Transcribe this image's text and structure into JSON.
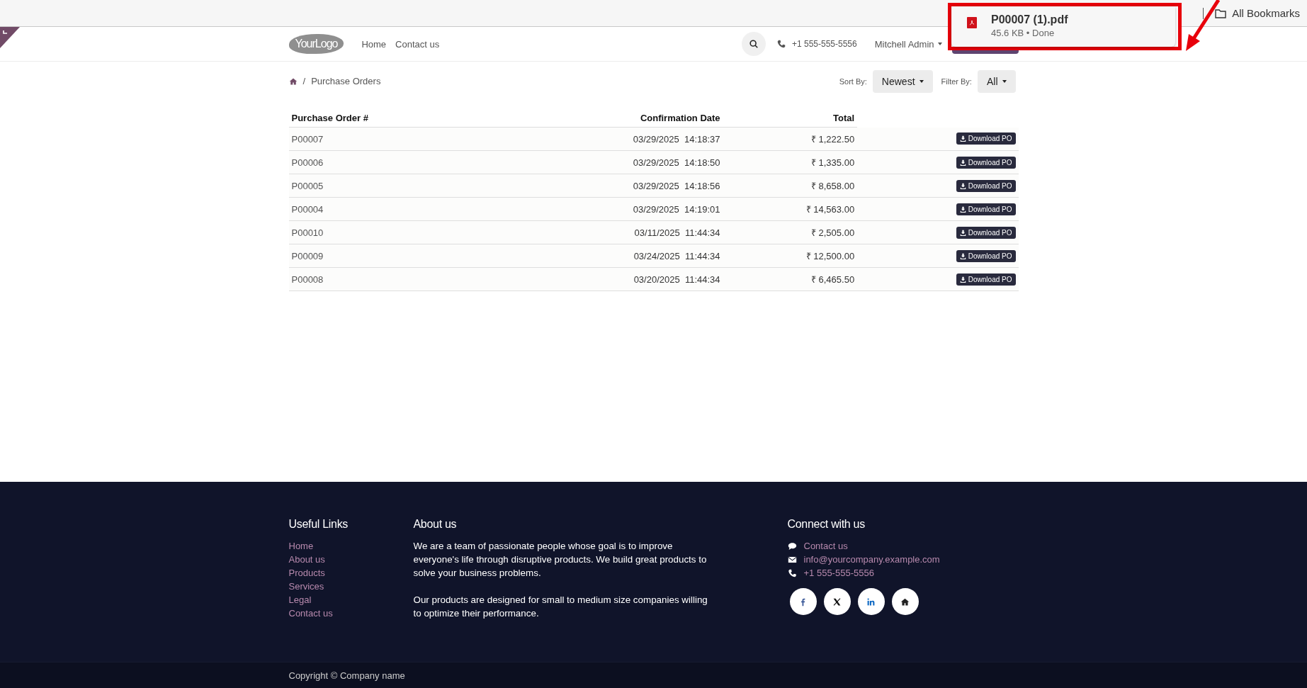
{
  "browser": {
    "bookmarks_label": "All Bookmarks",
    "download": {
      "filename": "P00007 (1).pdf",
      "status": "45.6 KB • Done"
    }
  },
  "header": {
    "logo": "**Your**Logo",
    "nav": [
      {
        "label": "Home"
      },
      {
        "label": "Contact us"
      }
    ],
    "phone": "+1 555-555-5556",
    "user": "Mitchell Admin"
  },
  "toolbar": {
    "separator": "/",
    "breadcrumb": "Purchase Orders",
    "sort_label": "Sort By:",
    "sort": "Newest",
    "filter_label": "Filter By:",
    "filter": "All"
  },
  "table": {
    "columns": [
      "Purchase Order #",
      "Confirmation Date",
      "Total"
    ],
    "rows": [
      {
        "number": "P00007",
        "date": "03/29/2025  14:18:37",
        "total": "₹ 1,222.50",
        "action": "Download PO"
      },
      {
        "number": "P00006",
        "date": "03/29/2025  14:18:50",
        "total": "₹ 1,335.00",
        "action": "Download PO"
      },
      {
        "number": "P00005",
        "date": "03/29/2025  14:18:56",
        "total": "₹ 8,658.00",
        "action": "Download PO"
      },
      {
        "number": "P00004",
        "date": "03/29/2025  14:19:01",
        "total": "₹ 14,563.00",
        "action": "Download PO"
      },
      {
        "number": "P00010",
        "date": "03/11/2025  11:44:34",
        "total": "₹ 2,505.00",
        "action": "Download PO"
      },
      {
        "number": "P00009",
        "date": "03/24/2025  11:44:34",
        "total": "₹ 12,500.00",
        "action": "Download PO"
      },
      {
        "number": "P00008",
        "date": "03/20/2025  11:44:34",
        "total": "₹ 6,465.50",
        "action": "Download PO"
      }
    ]
  },
  "footer": {
    "links_title": "Useful Links",
    "links": [
      "Home",
      "About us",
      "Products",
      "Services",
      "Legal",
      "Contact us"
    ],
    "about_title": "About us",
    "about": [
      "We are a team of passionate people whose goal is to improve everyone's life through disruptive products. We build great products to solve your business problems.",
      "Our products are designed for small to medium size companies willing to optimize their performance."
    ],
    "connect_title": "Connect with us",
    "contacts": [
      {
        "kind": "chat",
        "text": "Contact us"
      },
      {
        "kind": "email",
        "text": "info@yourcompany.example.com"
      },
      {
        "kind": "phone",
        "text": "+1 555-555-5556"
      }
    ],
    "social": [
      {
        "kind": "facebook"
      },
      {
        "kind": "x"
      },
      {
        "kind": "linkedin"
      },
      {
        "kind": "home"
      }
    ],
    "copyright": "Copyright © Company name"
  }
}
